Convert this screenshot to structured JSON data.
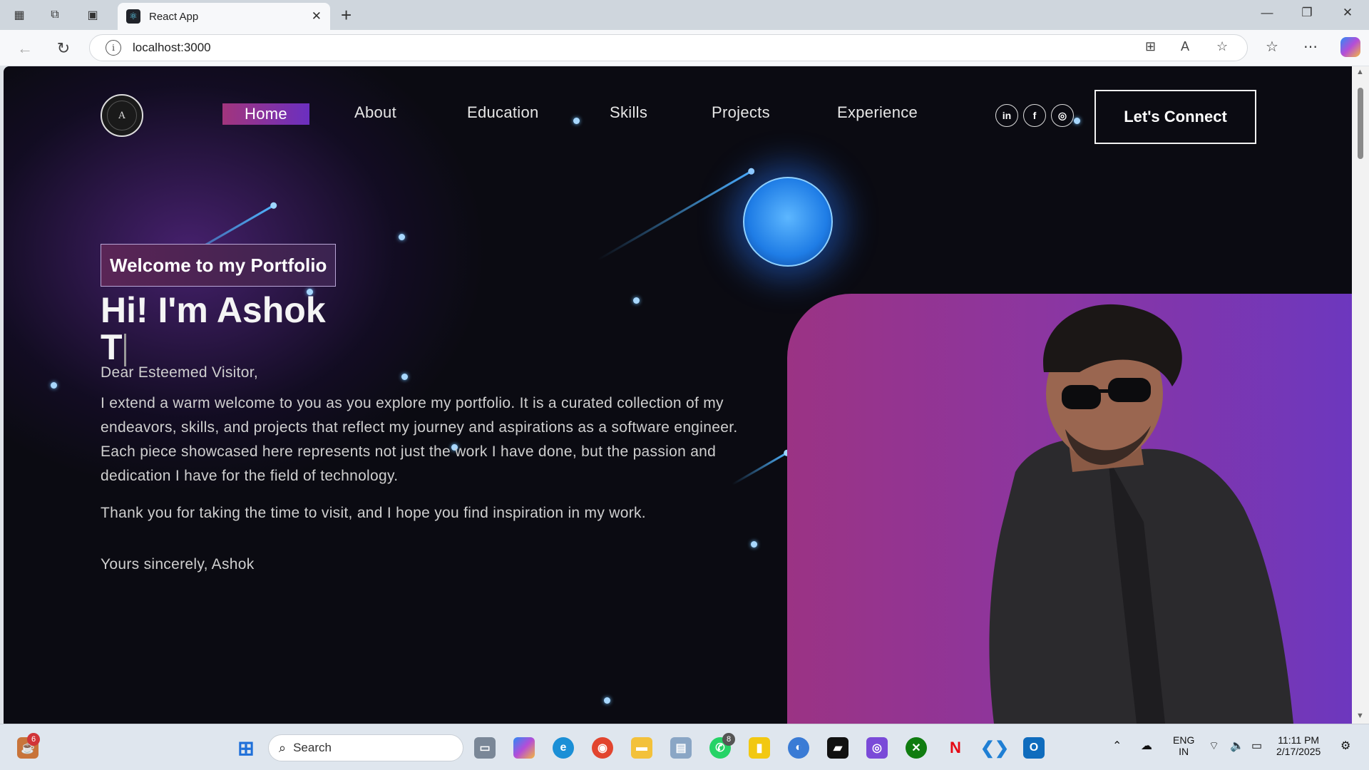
{
  "browser": {
    "tab_title": "React App",
    "url": "localhost:3000"
  },
  "nav": {
    "links": [
      "Home",
      "About",
      "Education",
      "Skills",
      "Projects",
      "Experience"
    ],
    "active": "Home",
    "social": [
      "in",
      "f",
      "◎"
    ],
    "connect_label": "Let's Connect"
  },
  "hero": {
    "badge": "Welcome to my Portfolio",
    "title_line1": "Hi! I'm Ashok",
    "title_line2": "T",
    "greeting": "Dear Esteemed Visitor,",
    "body": "I extend a warm welcome to you as you explore my portfolio. It is a curated collection of my endeavors, skills, and projects that reflect my journey and aspirations as a software engineer. Each piece showcased here represents not just the work I have done, but the passion and dedication I have for the field of technology.",
    "thanks": "Thank you for taking the time to visit, and I hope you find inspiration in my work.",
    "signature": "Yours sincerely, Ashok"
  },
  "taskbar": {
    "search_placeholder": "Search",
    "notification_count": "6",
    "whatsapp_badge": "8",
    "lang_line1": "ENG",
    "lang_line2": "IN",
    "time": "11:11 PM",
    "date": "2/17/2025"
  },
  "colors": {
    "accent_start": "#a2357d",
    "accent_end": "#6b2fc0",
    "background": "#0b0b12"
  }
}
